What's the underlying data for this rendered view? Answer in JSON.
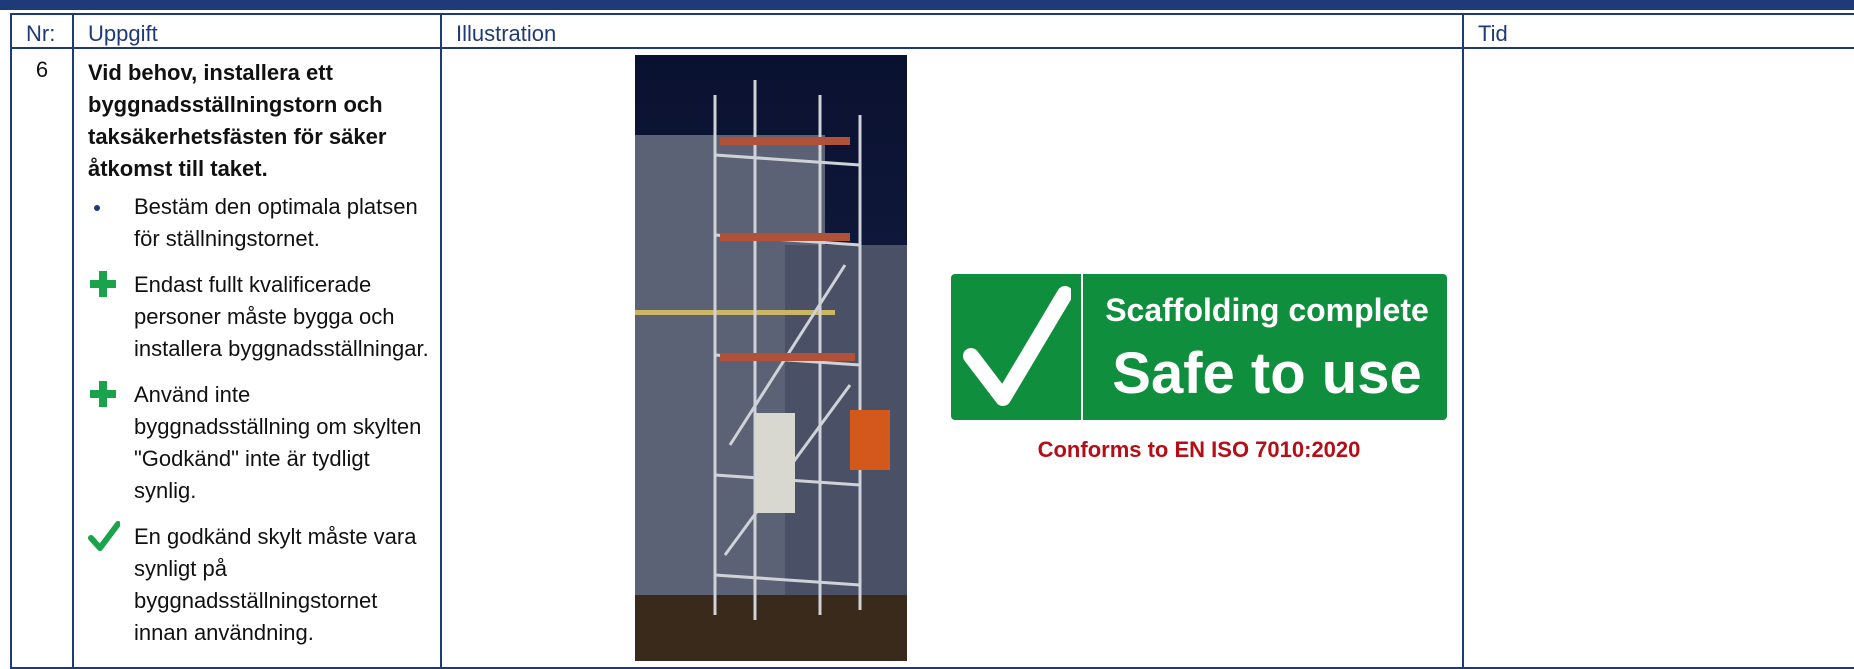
{
  "headers": {
    "nr": "Nr:",
    "task": "Uppgift",
    "illustration": "Illustration",
    "time": "Tid"
  },
  "row": {
    "nr": "6",
    "title": "Vid behov, installera ett byggnadsställningstorn och taksäkerhetsfästen för säker åtkomst till taket.",
    "steps": [
      {
        "icon": "bullet-icon",
        "text": "Bestäm den optimala platsen för ställningstornet."
      },
      {
        "icon": "green-plus-icon",
        "text": "Endast fullt kvalificerade personer måste bygga och installera byggnadsställningar."
      },
      {
        "icon": "green-plus-icon",
        "text": "Använd inte byggnadsställning om skylten \"Godkänd\" inte är tydligt synlig."
      },
      {
        "icon": "green-checkmark-icon",
        "text": "En godkänd skylt måste vara synligt på byggnadsställningstornet innan användning."
      }
    ],
    "time": ""
  },
  "illustration": {
    "photo": "scaffolding-tower-photo",
    "sign": {
      "line1": "Scaffolding complete",
      "line2": "Safe to use",
      "color": "#0f8f3d"
    },
    "caption": "Conforms to EN ISO 7010:2020"
  },
  "colors": {
    "border": "#1f3a78",
    "green": "#1aa34a",
    "caption": "#b50e16"
  }
}
